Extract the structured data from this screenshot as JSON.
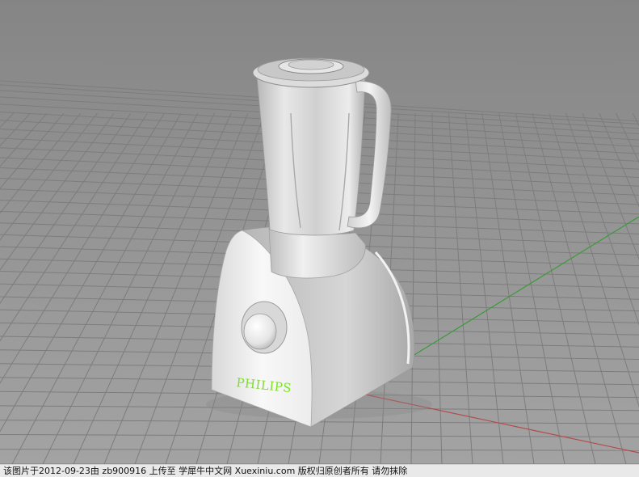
{
  "product": {
    "brand_label": "PHILIPS"
  },
  "caption": {
    "text": "该图片于2012-09-23由 zb900916 上传至 学犀牛中文网 Xuexiniu.com 版权归原创者所有 请勿抹除"
  },
  "colors": {
    "background_top": "#868686",
    "background_bottom": "#a2a2a2",
    "grid_line": "#7e7e7e",
    "axis_x": "#b44a4a",
    "axis_y": "#3a9a3a",
    "brand_text": "#7ee02a",
    "model_white": "#f4f4f4"
  }
}
